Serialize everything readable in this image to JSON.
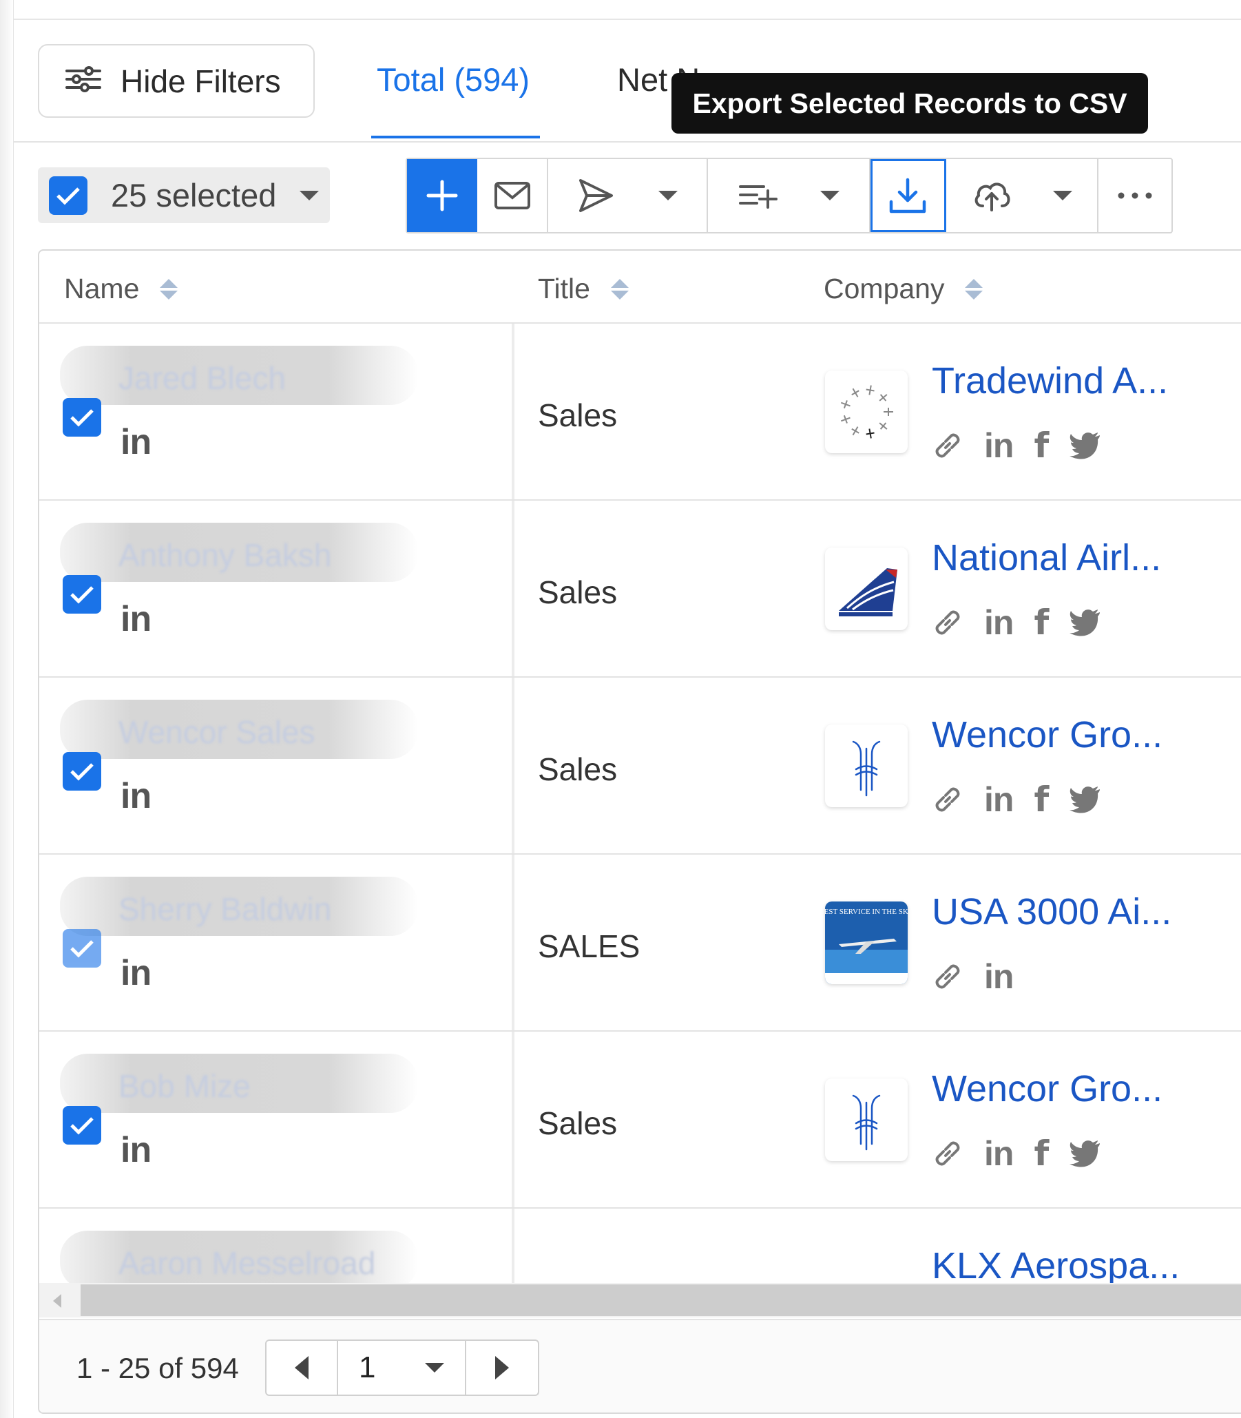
{
  "header": {
    "hide_filters_label": "Hide Filters",
    "tabs": [
      {
        "label": "Total (594)",
        "active": true
      },
      {
        "label": "Net N",
        "active": false
      }
    ],
    "tooltip": "Export Selected Records to CSV"
  },
  "toolbar": {
    "selected_label": "25 selected"
  },
  "table": {
    "columns": [
      "Name",
      "Title",
      "Company"
    ],
    "rows": [
      {
        "name": "Jared Blech",
        "title": "Sales",
        "company": "Tradewind A...",
        "logo": "airplane-circle-logo",
        "socials": [
          "link",
          "linkedin",
          "facebook",
          "twitter"
        ]
      },
      {
        "name": "Anthony Baksh",
        "title": "Sales",
        "company": "National Airl...",
        "logo": "national-tail-logo",
        "socials": [
          "link",
          "linkedin",
          "facebook",
          "twitter"
        ]
      },
      {
        "name": "Wencor Sales",
        "title": "Sales",
        "company": "Wencor Gro...",
        "logo": "wencor-logo",
        "socials": [
          "link",
          "linkedin",
          "facebook",
          "twitter"
        ]
      },
      {
        "name": "Sherry Baldwin",
        "title": "SALES",
        "company": "USA 3000 Ai...",
        "logo": "usa3000-logo",
        "logo_text": "BEST SERVICE IN THE SKY",
        "socials": [
          "link",
          "linkedin"
        ]
      },
      {
        "name": "Bob Mize",
        "title": "Sales",
        "company": "Wencor Gro...",
        "logo": "wencor-logo",
        "socials": [
          "link",
          "linkedin",
          "facebook",
          "twitter"
        ]
      },
      {
        "name": "Aaron Messelroad",
        "title": "",
        "company": "KLX Aerospa...",
        "logo": "",
        "socials": []
      }
    ],
    "linkedin_glyph": "in",
    "facebook_glyph": "f"
  },
  "footer": {
    "range": "1 - 25 of 594",
    "page": "1"
  },
  "colors": {
    "accent": "#1a73e8",
    "company_link": "#1a56c4",
    "tooltip_bg": "#111111"
  }
}
